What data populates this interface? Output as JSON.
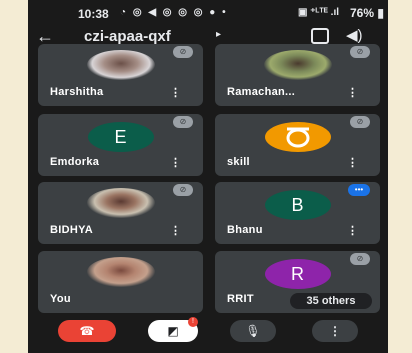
{
  "status_bar": {
    "time": "10:38",
    "left_icons": "◔ ◎ ◀ ◎ ◎ ◎ ● •",
    "right_icons": "▣ ⁺ᴸᵀᴱ .ıl",
    "battery": "76% ▮"
  },
  "toolbar": {
    "back_glyph": "←",
    "meeting_code": "czi-apaa-qxf",
    "caret_glyph": "▸",
    "speaker_glyph": "◀)"
  },
  "tiles": [
    {
      "name": "Harshitha",
      "avatar_letter": "",
      "muted": true
    },
    {
      "name": "Ramachan...",
      "avatar_letter": "",
      "muted": true
    },
    {
      "name": "Emdorka",
      "avatar_letter": "E",
      "muted": true
    },
    {
      "name": "skill",
      "avatar_letter": "",
      "muted": true
    },
    {
      "name": "BIDHYA",
      "avatar_letter": "",
      "muted": true
    },
    {
      "name": "Bhanu",
      "avatar_letter": "B",
      "muted": false
    },
    {
      "name": "You",
      "avatar_letter": "",
      "muted": false
    },
    {
      "name": "RRIT",
      "avatar_letter": "R",
      "muted": true
    }
  ],
  "others_label": "35 others",
  "menu_glyph": "⋮",
  "mute_glyph": "⊘",
  "talk_glyph": "•••",
  "bottom_bar": {
    "end_glyph": "☎",
    "camera_glyph": "◩",
    "camera_badge": "!",
    "mic_glyph": "🎙",
    "more_glyph": "⋮"
  },
  "colors": {
    "tile_bg": "#3c4043",
    "end_call": "#ea4335",
    "avatar_e": "#0b5d4a",
    "avatar_skill": "#f29900",
    "avatar_b": "#0b5d4a",
    "avatar_r": "#8e24aa",
    "speaking": "#1a73e8"
  }
}
